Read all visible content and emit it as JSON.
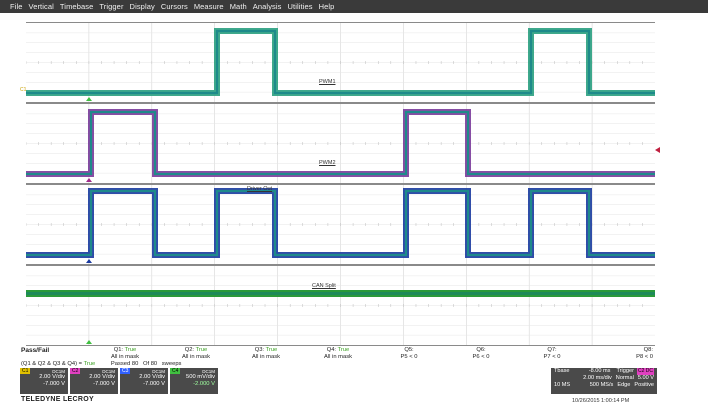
{
  "menu": [
    "File",
    "Vertical",
    "Timebase",
    "Trigger",
    "Display",
    "Cursors",
    "Measure",
    "Math",
    "Analysis",
    "Utilities",
    "Help"
  ],
  "traces": {
    "pwm1_label": "PWM1",
    "pwm2_label": "PWM2",
    "driver_label": "Driver Out",
    "can_label": "CAN Split",
    "colors": {
      "teal": "#1e8a8a",
      "blue": "#1a3aa0",
      "green": "#2a9a3a",
      "magenta": "#a02a8a"
    }
  },
  "passfail": {
    "title": "Pass/Fail",
    "expr": "(Q1 & Q2 & Q3 & Q4) = ",
    "expr_val": "True",
    "passed_label": "Passed",
    "passed_val": "80",
    "of_label": "Of",
    "of_val": "80",
    "sweeps": "sweeps",
    "columns": [
      {
        "q": "Q1:",
        "val": "True",
        "desc": "All in mask"
      },
      {
        "q": "Q2:",
        "val": "True",
        "desc": "All in mask"
      },
      {
        "q": "Q3:",
        "val": "True",
        "desc": "All in mask"
      },
      {
        "q": "Q4:",
        "val": "True",
        "desc": "All in mask"
      },
      {
        "q": "Q5:",
        "val": "",
        "desc": "P5 < 0"
      },
      {
        "q": "Q6:",
        "val": "",
        "desc": "P6 < 0"
      },
      {
        "q": "Q7:",
        "val": "",
        "desc": "P7 < 0"
      },
      {
        "q": "Q8:",
        "val": "",
        "desc": "P8 < 0"
      }
    ]
  },
  "channels": [
    {
      "tag": "C1",
      "mode": "DC1M",
      "vdiv": "2.00 V/div",
      "offset": "-7.000 V",
      "color": "#e0c000"
    },
    {
      "tag": "C2",
      "mode": "DC1M",
      "vdiv": "2.00 V/div",
      "offset": "-7.000 V",
      "color": "#e040c0"
    },
    {
      "tag": "C3",
      "mode": "DC1M",
      "vdiv": "2.00 V/div",
      "offset": "-7.000 V",
      "color": "#3060ff"
    },
    {
      "tag": "C4",
      "mode": "DC1M",
      "vdiv": "500 mV/div",
      "offset": "-2.000 V",
      "color": "#40c040"
    }
  ],
  "timebase": {
    "tbase_label": "Tbase",
    "tbase_val": "-8.00 ms",
    "trigger_label": "Trigger",
    "trigger_tag": "C2 DC",
    "tdiv": "2.00 ms/div",
    "trig_mode": "Normal",
    "trig_level": "5.00 V",
    "samples": "10 MS",
    "srate": "500 MS/s",
    "trig_type": "Edge",
    "trig_slope": "Positive"
  },
  "brand": "TELEDYNE LECROY",
  "timestamp": "10/26/2015 1:00:14 PM"
}
